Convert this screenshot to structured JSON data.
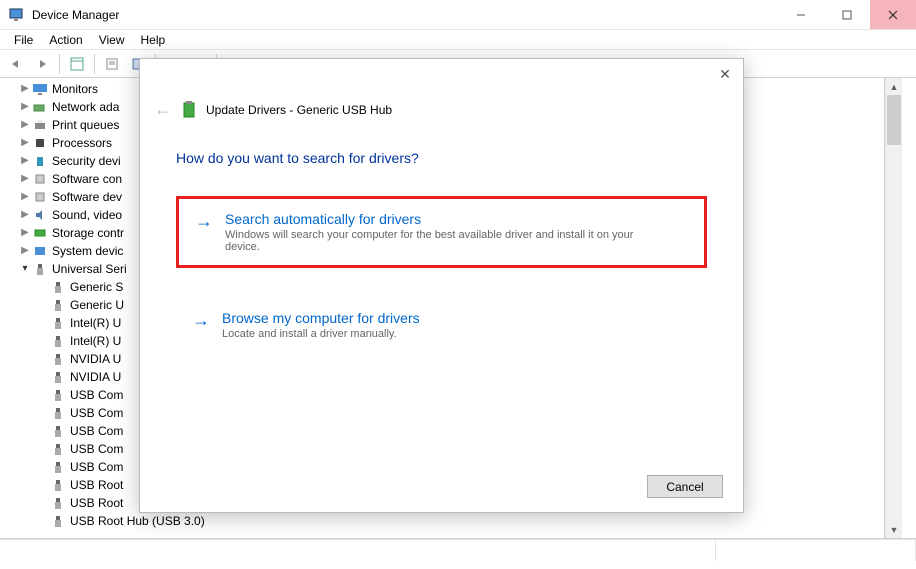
{
  "window": {
    "title": "Device Manager"
  },
  "menu": {
    "file": "File",
    "action": "Action",
    "view": "View",
    "help": "Help"
  },
  "tree": {
    "monitors": "Monitors",
    "network": "Network ada",
    "print": "Print queues",
    "processors": "Processors",
    "security": "Security devi",
    "swcomp1": "Software con",
    "swcomp2": "Software dev",
    "sound": "Sound, video",
    "storage": "Storage contr",
    "system": "System devic",
    "usb": "Universal Seri",
    "usb_children": {
      "generic_s": "Generic S",
      "generic_u": "Generic U",
      "intel1": "Intel(R) U",
      "intel2": "Intel(R) U",
      "nvidia1": "NVIDIA U",
      "nvidia2": "NVIDIA U",
      "usbcom1": "USB Com",
      "usbcom2": "USB Com",
      "usbcom3": "USB Com",
      "usbcom4": "USB Com",
      "usbcom5": "USB Com",
      "usbroot1": "USB Root",
      "usbroot2": "USB Root",
      "usbroot3": "USB Root Hub (USB 3.0)"
    }
  },
  "dialog": {
    "title": "Update Drivers - Generic USB Hub",
    "heading": "How do you want to search for drivers?",
    "option1": {
      "title": "Search automatically for drivers",
      "desc": "Windows will search your computer for the best available driver and install it on your device."
    },
    "option2": {
      "title": "Browse my computer for drivers",
      "desc": "Locate and install a driver manually."
    },
    "cancel": "Cancel"
  }
}
